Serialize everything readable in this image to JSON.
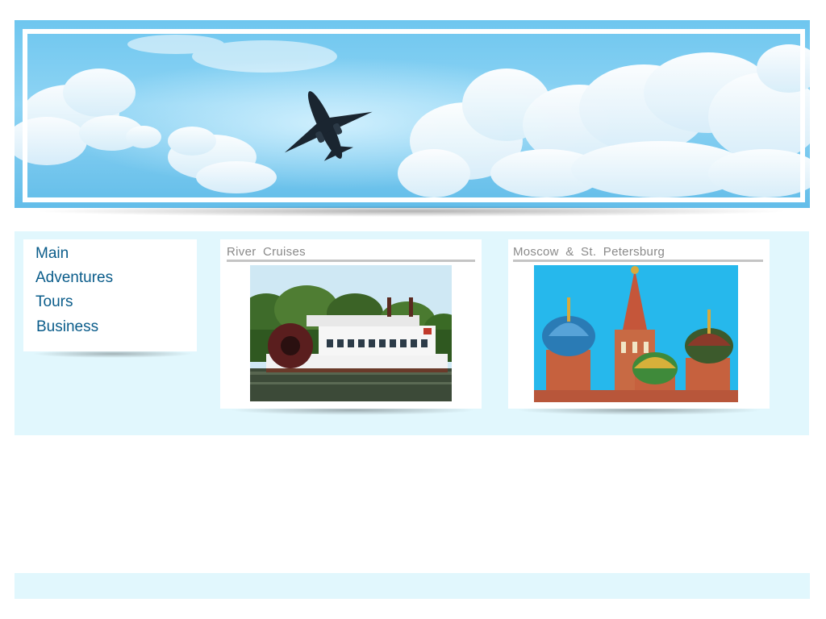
{
  "nav": {
    "items": [
      {
        "label": "Main"
      },
      {
        "label": "Adventures"
      },
      {
        "label": "Tours"
      },
      {
        "label": "Business"
      }
    ]
  },
  "cards": [
    {
      "title": "River  Cruises",
      "image": "paddle-steamer-riverboat-photo"
    },
    {
      "title": "Moscow  &  St.  Petersburg",
      "image": "st-basils-cathedral-domes-photo"
    }
  ],
  "banner": {
    "image": "airplane-in-cloudy-sky-photo"
  },
  "colors": {
    "nav_link": "#0a5c8a",
    "card_title": "#8a8a8a",
    "content_band": "#e1f7fd",
    "sky": "#7ccdf2"
  }
}
